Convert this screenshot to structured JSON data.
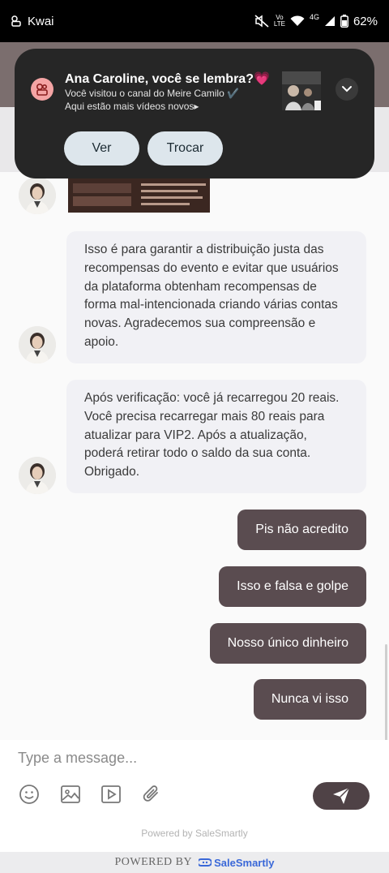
{
  "status_bar": {
    "app_name": "Kwai",
    "network_top": "Vo",
    "network_bottom": "LTE",
    "signal_type": "4G",
    "battery": "62%"
  },
  "notification": {
    "title": "Ana Caroline, você se lembra?💗",
    "line1": "Você visitou o canal do Meire Camilo ✔️",
    "line2": "Aqui estão mais vídeos novos▸",
    "button_view": "Ver",
    "button_switch": "Trocar"
  },
  "chat": {
    "messages_in": [
      {
        "text": "Isso é para garantir a distribuição justa das recompensas do evento e evitar que usuários da plataforma obtenham recompensas de forma mal-intencionada criando várias contas novas. Agradecemos sua compreensão e apoio."
      },
      {
        "text": "Após verificação: você já recarregou 20 reais. Você precisa recarregar mais 80 reais para atualizar para VIP2. Após a atualização, poderá retirar todo o saldo da sua conta. Obrigado."
      }
    ],
    "messages_out": [
      {
        "text": "Pis não acredito"
      },
      {
        "text": "Isso e falsa e golpe"
      },
      {
        "text": "Nosso único dinheiro"
      },
      {
        "text": "Nunca vi isso"
      }
    ]
  },
  "composer": {
    "placeholder": "Type a message...",
    "tools": [
      "emoji-icon",
      "image-icon",
      "video-icon",
      "attachment-icon"
    ],
    "powered_by": "Powered by SaleSmartly"
  },
  "footer": {
    "powered_label": "POWERED BY",
    "brand": "SaleSmartly"
  },
  "colors": {
    "bubble_out": "#5a4c50",
    "bubble_in": "#f1f1f5",
    "notification_bg": "#262626",
    "brand_blue": "#3a68d8"
  }
}
